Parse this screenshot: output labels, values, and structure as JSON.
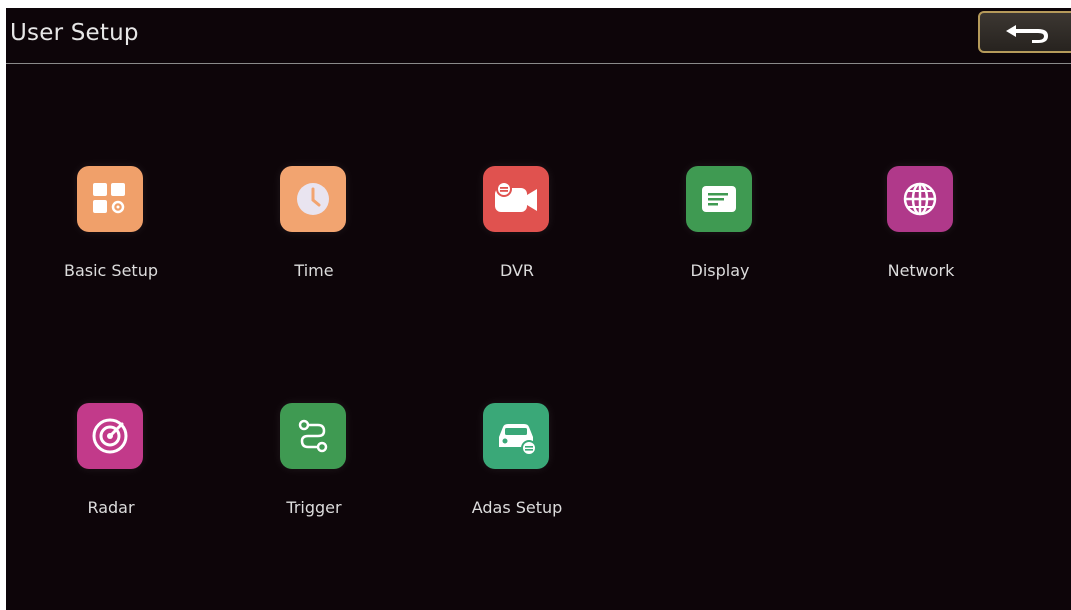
{
  "header": {
    "title": "User Setup",
    "back_icon": "return-arrow-icon"
  },
  "menu": {
    "items": [
      {
        "label": "Basic Setup",
        "icon": "grid-settings-icon",
        "color": "#f0a06a"
      },
      {
        "label": "Time",
        "icon": "clock-icon",
        "color": "#f2a470"
      },
      {
        "label": "DVR",
        "icon": "video-camera-icon",
        "color": "#e0524f"
      },
      {
        "label": "Display",
        "icon": "display-text-icon",
        "color": "#3f9a52"
      },
      {
        "label": "Network",
        "icon": "globe-icon",
        "color": "#b0398a"
      },
      {
        "label": "Radar",
        "icon": "radar-icon",
        "color": "#c23a8a"
      },
      {
        "label": "Trigger",
        "icon": "route-icon",
        "color": "#3f9a52"
      },
      {
        "label": "Adas Setup",
        "icon": "car-settings-icon",
        "color": "#3aa878"
      }
    ]
  }
}
